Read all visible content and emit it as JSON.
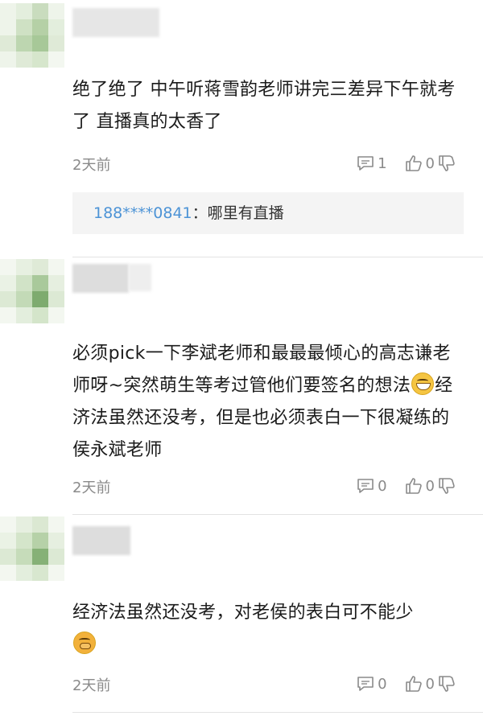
{
  "comments": [
    {
      "text": "绝了绝了 中午听蒋雪韵老师讲完三差异下午就考了 直播真的太香了",
      "time": "2天前",
      "reply_count": "1",
      "like_count": "0",
      "reply": {
        "name": "188****0841",
        "separator": "：",
        "text": "哪里有直播"
      }
    },
    {
      "text_part1": "必须pick一下李斌老师和最最最倾心的高志谦老师呀~突然萌生等考过管他们要签名的想法",
      "text_part2": "经济法虽然还没考，但是也必须表白一下很凝练的侯永斌老师",
      "time": "2天前",
      "reply_count": "0",
      "like_count": "0"
    },
    {
      "text": "经济法虽然还没考，对老侯的表白可不能少",
      "time": "2天前",
      "reply_count": "0",
      "like_count": "0"
    }
  ],
  "colors": {
    "reply_name": "#4c93d6",
    "meta_gray": "#8a8a8a",
    "avatar_green_dark": "#7eab6f",
    "avatar_green_light": "#d6e6cc"
  },
  "icons": {
    "reply": "comment-icon",
    "like": "thumbs-up-icon",
    "dislike": "thumbs-down-icon"
  }
}
